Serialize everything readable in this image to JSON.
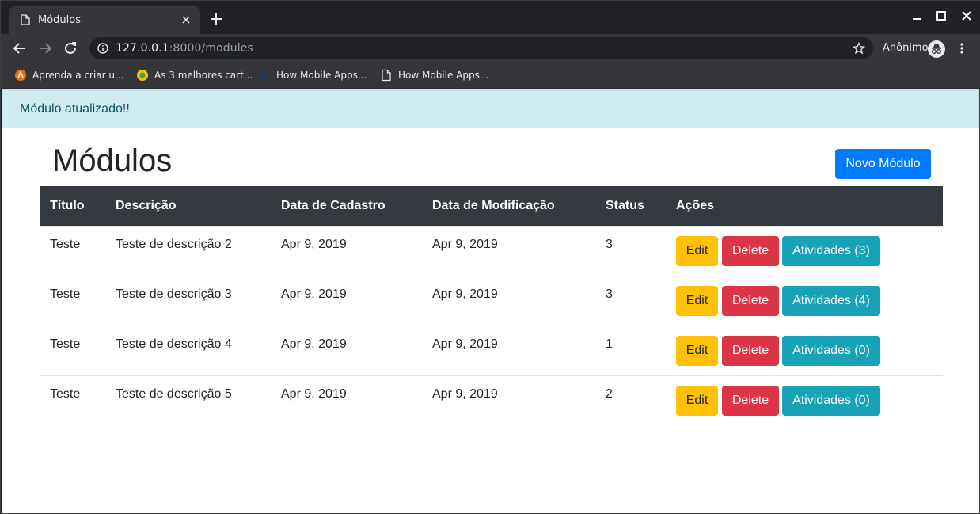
{
  "browser": {
    "tab_title": "Módulos",
    "url_host": "127.0.0.1",
    "url_rest": ":8000/modules",
    "profile_label": "Anônimo",
    "bookmarks": [
      {
        "label": "Aprenda a criar u..."
      },
      {
        "label": "As 3 melhores cart..."
      },
      {
        "label": "How Mobile Apps..."
      },
      {
        "label": "How Mobile Apps..."
      }
    ]
  },
  "alert": {
    "message": "Módulo atualizado!!"
  },
  "page": {
    "title": "Módulos",
    "new_button": "Novo Módulo"
  },
  "table": {
    "headers": [
      "Título",
      "Descrição",
      "Data de Cadastro",
      "Data de Modificação",
      "Status",
      "Ações"
    ],
    "rows": [
      {
        "titulo": "Teste",
        "descricao": "Teste de descrição 2",
        "cadastro": "Apr 9, 2019",
        "modificacao": "Apr 9, 2019",
        "status": "3",
        "edit": "Edit",
        "delete": "Delete",
        "atividades": "Atividades (3)"
      },
      {
        "titulo": "Teste",
        "descricao": "Teste de descrição 3",
        "cadastro": "Apr 9, 2019",
        "modificacao": "Apr 9, 2019",
        "status": "3",
        "edit": "Edit",
        "delete": "Delete",
        "atividades": "Atividades (4)"
      },
      {
        "titulo": "Teste",
        "descricao": "Teste de descrição 4",
        "cadastro": "Apr 9, 2019",
        "modificacao": "Apr 9, 2019",
        "status": "1",
        "edit": "Edit",
        "delete": "Delete",
        "atividades": "Atividades (0)"
      },
      {
        "titulo": "Teste",
        "descricao": "Teste de descrição 5",
        "cadastro": "Apr 9, 2019",
        "modificacao": "Apr 9, 2019",
        "status": "2",
        "edit": "Edit",
        "delete": "Delete",
        "atividades": "Atividades (0)"
      }
    ]
  },
  "colors": {
    "primary": "#007bff",
    "warning": "#ffc107",
    "danger": "#dc3545",
    "info": "#17a2b8",
    "alert_bg": "#d1ecf1",
    "table_head": "#343a40"
  }
}
